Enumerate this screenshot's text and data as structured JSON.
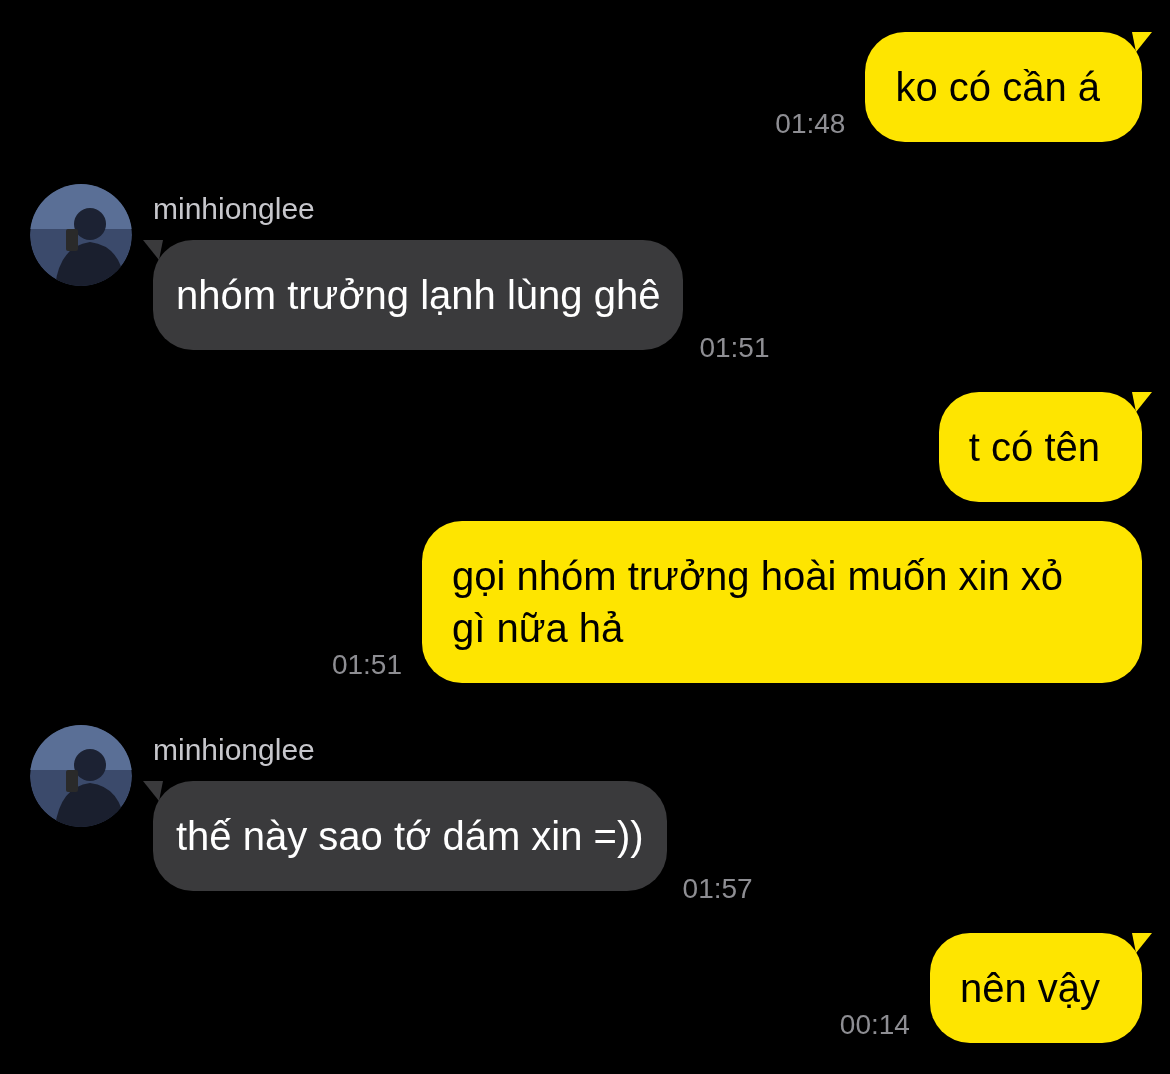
{
  "messages": [
    {
      "kind": "sent",
      "text": "ko có cần á",
      "time": "01:48",
      "first": true
    },
    {
      "kind": "received",
      "sender": "minhionglee",
      "text": "nhóm trưởng lạnh lùng ghê",
      "time": "01:51"
    },
    {
      "kind": "sent",
      "text": "t có tên",
      "first": true
    },
    {
      "kind": "sent",
      "text": "gọi nhóm trưởng hoài muốn xin xỏ gì nữa hả",
      "time": "01:51",
      "first": false
    },
    {
      "kind": "received",
      "sender": "minhionglee",
      "text": "thế này sao tớ dám xin =))",
      "time": "01:57"
    },
    {
      "kind": "sent",
      "text": "nên vậy",
      "time": "00:14",
      "first": true
    }
  ]
}
